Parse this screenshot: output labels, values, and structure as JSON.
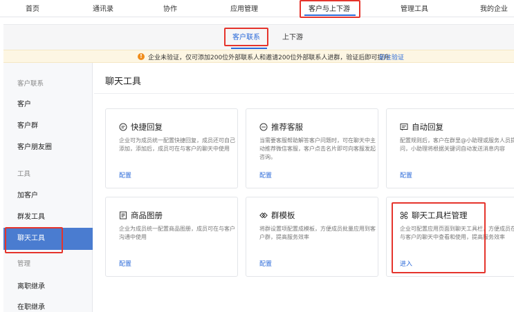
{
  "topnav": {
    "items": [
      "首页",
      "通讯录",
      "协作",
      "应用管理",
      "客户与上下游",
      "管理工具",
      "我的企业"
    ],
    "active_index": 4
  },
  "subtabs": {
    "items": [
      "客户联系",
      "上下游"
    ],
    "active_index": 0
  },
  "notice": {
    "message": "企业未验证，仅可添加200位外部联系人和邀请200位外部联系人进群，验证后即可提升",
    "link": "前往验证"
  },
  "sidebar": {
    "items": [
      {
        "label": "客户联系",
        "type": "group"
      },
      {
        "label": "客户",
        "type": "item"
      },
      {
        "label": "客户群",
        "type": "item"
      },
      {
        "label": "客户朋友圈",
        "type": "item"
      },
      {
        "label": "工具",
        "type": "group"
      },
      {
        "label": "加客户",
        "type": "item"
      },
      {
        "label": "群发工具",
        "type": "item"
      },
      {
        "label": "聊天工具",
        "type": "item",
        "active": true
      },
      {
        "label": "管理",
        "type": "group"
      },
      {
        "label": "离职继承",
        "type": "item"
      },
      {
        "label": "在职继承",
        "type": "item"
      }
    ]
  },
  "main": {
    "title": "聊天工具",
    "cards": [
      {
        "icon": "quick-reply-icon",
        "title": "快捷回复",
        "desc": "企业可为成员统一配置快捷回复，成员还可自己添加，添加后，成员可在与客户的聊天中使用",
        "action": "配置"
      },
      {
        "icon": "recommend-service-icon",
        "title": "推荐客服",
        "desc": "当需要客服帮助解答客户问题时，可在聊天中主动推荐微信客服，客户点击名片即可向客服发起咨询。",
        "action": "配置"
      },
      {
        "icon": "auto-reply-icon",
        "title": "自动回复",
        "desc": "配置规则后，客户在群里@小助理或服务人员提问，小助理将根据关键词自动发送消息内容",
        "action": "配置"
      },
      {
        "icon": "product-album-icon",
        "title": "商品图册",
        "desc": "企业为成员统一配置商品图册，成员可在与客户沟通中使用",
        "action": "配置"
      },
      {
        "icon": "group-template-icon",
        "title": "群模板",
        "desc": "将群设置项配置成模板，方便成员批量应用到客户群，提高服务效率",
        "action": "配置"
      },
      {
        "icon": "toolbar-manage-icon",
        "title": "聊天工具栏管理",
        "desc": "企业可配置应用页面到聊天工具栏，方便成员在与客户的聊天中查看和使用，提高服务效率",
        "action": "进入"
      }
    ]
  },
  "colors": {
    "accent": "#2b6ad9",
    "sidebar_active": "#4a7cd0",
    "highlight_box": "#e5332b",
    "warning": "#f08c1a"
  }
}
